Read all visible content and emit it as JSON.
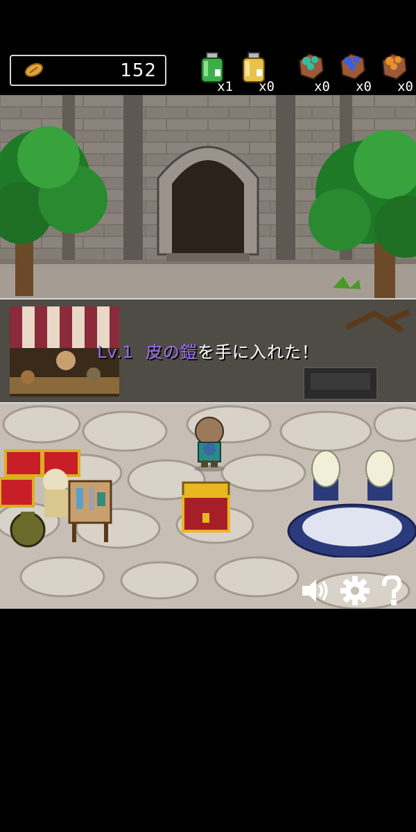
{
  "hud": {
    "coins": "152",
    "items": [
      {
        "name": "green-potion-icon",
        "count": "x1",
        "color": "#3bb04a"
      },
      {
        "name": "yellow-potion-icon",
        "count": "x0",
        "color": "#e8c24a"
      },
      {
        "name": "green-ore-icon",
        "count": "x0",
        "color": "#2ec0a0"
      },
      {
        "name": "blue-ore-icon",
        "count": "x0",
        "color": "#3a5fe0"
      },
      {
        "name": "orange-ore-icon",
        "count": "x0",
        "color": "#e8902a"
      }
    ]
  },
  "message": {
    "level": "Lv.1",
    "item_name": "皮の鎧",
    "suffix": "を手に入れた！"
  },
  "colors": {
    "accent_purple": "#9b6ef5",
    "divider": "#d7d7d7"
  }
}
